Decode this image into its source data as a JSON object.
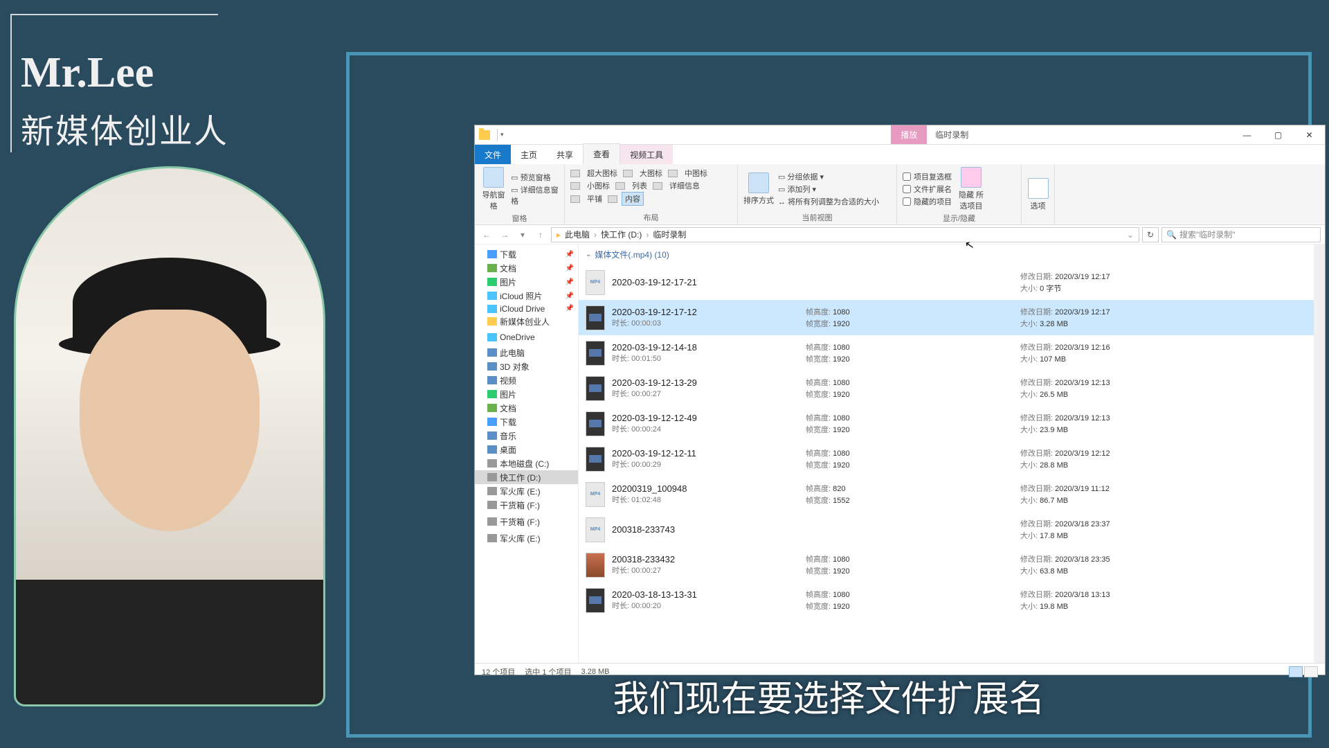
{
  "presenter": {
    "name": "Mr.Lee",
    "subtitle": "新媒体创业人"
  },
  "window": {
    "contextual_tab": "播放",
    "title": "临时录制",
    "controls": {
      "min": "—",
      "max": "▢",
      "close": "✕"
    },
    "tabs": {
      "file": "文件",
      "home": "主页",
      "share": "共享",
      "view": "查看",
      "video": "视频工具"
    }
  },
  "ribbon": {
    "panes": {
      "nav_pane": "导航窗格",
      "preview": "预览窗格",
      "details": "详细信息窗格",
      "group_panes": "窗格"
    },
    "layout": {
      "extra_large": "超大图标",
      "large": "大图标",
      "medium": "中图标",
      "small": "小图标",
      "list": "列表",
      "details": "详细信息",
      "tiles": "平铺",
      "content": "内容",
      "group_layout": "布局"
    },
    "current": {
      "sort": "排序方式",
      "groupby": "分组依据",
      "addcol": "添加列",
      "autosize": "将所有列调整为合适的大小",
      "group_current": "当前视图"
    },
    "showhide": {
      "itemcheck": "项目复选框",
      "ext": "文件扩展名",
      "hidden": "隐藏的项目",
      "hide": "隐藏\n所选项目",
      "group_showhide": "显示/隐藏"
    },
    "options": "选项"
  },
  "address": {
    "parts": [
      "此电脑",
      "快工作 (D:)",
      "临时录制"
    ],
    "search_placeholder": "搜索\"临时录制\""
  },
  "nav": [
    {
      "icon": "dl",
      "label": "下载",
      "pin": "📌"
    },
    {
      "icon": "doc",
      "label": "文档",
      "pin": "📌"
    },
    {
      "icon": "pic",
      "label": "图片",
      "pin": "📌"
    },
    {
      "icon": "cloud",
      "label": "iCloud 照片",
      "pin": "📌"
    },
    {
      "icon": "cloud",
      "label": "iCloud Drive",
      "pin": "📌"
    },
    {
      "icon": "fold",
      "label": "新媒体创业人",
      "pin": ""
    },
    {
      "icon": "spacer"
    },
    {
      "icon": "cloud",
      "label": "OneDrive"
    },
    {
      "icon": "spacer"
    },
    {
      "icon": "pc",
      "label": "此电脑"
    },
    {
      "icon": "pc",
      "label": "3D 对象"
    },
    {
      "icon": "pc",
      "label": "视频"
    },
    {
      "icon": "pic",
      "label": "图片"
    },
    {
      "icon": "doc",
      "label": "文档"
    },
    {
      "icon": "dl",
      "label": "下载"
    },
    {
      "icon": "pc",
      "label": "音乐"
    },
    {
      "icon": "pc",
      "label": "桌面"
    },
    {
      "icon": "drive",
      "label": "本地磁盘 (C:)"
    },
    {
      "icon": "drive",
      "label": "快工作 (D:)",
      "sel": true
    },
    {
      "icon": "drive",
      "label": "军火库 (E:)"
    },
    {
      "icon": "drive",
      "label": "干货箱 (F:)"
    },
    {
      "icon": "spacer"
    },
    {
      "icon": "drive",
      "label": "干货箱 (F:)"
    },
    {
      "icon": "spacer"
    },
    {
      "icon": "drive",
      "label": "军火库 (E:)"
    }
  ],
  "labels": {
    "group_header": "媒体文件(.mp4) (10)",
    "duration": "时长:",
    "fh": "帧高度:",
    "fw": "帧宽度:",
    "mod": "修改日期:",
    "size": "大小:"
  },
  "files": [
    {
      "thumb": "mp4",
      "name": "2020-03-19-12-17-21",
      "dur": "",
      "fh": "",
      "fw": "",
      "mod": "2020/3/19 12:17",
      "size": "0 字节"
    },
    {
      "thumb": "vid",
      "name": "2020-03-19-12-17-12",
      "dur": "00:00:03",
      "fh": "1080",
      "fw": "1920",
      "mod": "2020/3/19 12:17",
      "size": "3.28 MB",
      "sel": true
    },
    {
      "thumb": "vid",
      "name": "2020-03-19-12-14-18",
      "dur": "00:01:50",
      "fh": "1080",
      "fw": "1920",
      "mod": "2020/3/19 12:16",
      "size": "107 MB"
    },
    {
      "thumb": "vid",
      "name": "2020-03-19-12-13-29",
      "dur": "00:00:27",
      "fh": "1080",
      "fw": "1920",
      "mod": "2020/3/19 12:13",
      "size": "26.5 MB"
    },
    {
      "thumb": "vid",
      "name": "2020-03-19-12-12-49",
      "dur": "00:00:24",
      "fh": "1080",
      "fw": "1920",
      "mod": "2020/3/19 12:13",
      "size": "23.9 MB"
    },
    {
      "thumb": "vid",
      "name": "2020-03-19-12-12-11",
      "dur": "00:00:29",
      "fh": "1080",
      "fw": "1920",
      "mod": "2020/3/19 12:12",
      "size": "28.8 MB"
    },
    {
      "thumb": "mp4",
      "name": "20200319_100948",
      "dur": "01:02:48",
      "fh": "820",
      "fw": "1552",
      "mod": "2020/3/19 11:12",
      "size": "86.7 MB"
    },
    {
      "thumb": "mp4",
      "name": "200318-233743",
      "dur": "",
      "fh": "",
      "fw": "",
      "mod": "2020/3/18 23:37",
      "size": "17.8 MB"
    },
    {
      "thumb": "person",
      "name": "200318-233432",
      "dur": "00:00:27",
      "fh": "1080",
      "fw": "1920",
      "mod": "2020/3/18 23:35",
      "size": "63.8 MB"
    },
    {
      "thumb": "vid",
      "name": "2020-03-18-13-13-31",
      "dur": "00:00:20",
      "fh": "1080",
      "fw": "1920",
      "mod": "2020/3/18 13:13",
      "size": "19.8 MB"
    }
  ],
  "status": {
    "count": "12 个项目",
    "selected": "选中 1 个项目",
    "selsize": "3.28 MB"
  },
  "caption": "我们现在要选择文件扩展名"
}
